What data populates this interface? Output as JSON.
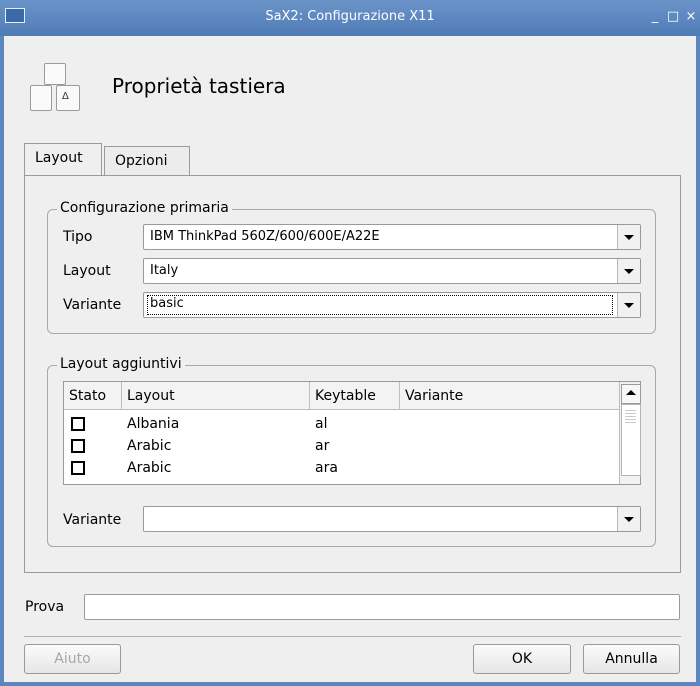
{
  "window": {
    "title": "SaX2: Configurazione X11",
    "controls": {
      "minimize": "_",
      "maximize": "□",
      "close": "×"
    }
  },
  "header": {
    "title": "Proprietà tastiera",
    "icon": "keyboard-icon"
  },
  "tabs": [
    {
      "label": "Layout",
      "active": true
    },
    {
      "label": "Opzioni",
      "active": false
    }
  ],
  "primary": {
    "group_label": "Configurazione primaria",
    "tipo_label": "Tipo",
    "tipo_value": "IBM ThinkPad 560Z/600/600E/A22E",
    "layout_label": "Layout",
    "layout_value": "Italy",
    "variante_label": "Variante",
    "variante_value": "basic"
  },
  "additional": {
    "group_label": "Layout aggiuntivi",
    "columns": [
      "Stato",
      "Layout",
      "Keytable",
      "Variante"
    ],
    "rows": [
      {
        "checked": false,
        "layout": "Albania",
        "keytable": "al",
        "variante": ""
      },
      {
        "checked": false,
        "layout": "Arabic",
        "keytable": "ar",
        "variante": ""
      },
      {
        "checked": false,
        "layout": "Arabic",
        "keytable": "ara",
        "variante": ""
      }
    ],
    "variante_label": "Variante",
    "variante_value": ""
  },
  "test": {
    "label": "Prova",
    "value": ""
  },
  "buttons": {
    "help": "Aiuto",
    "ok": "OK",
    "cancel": "Annulla"
  }
}
